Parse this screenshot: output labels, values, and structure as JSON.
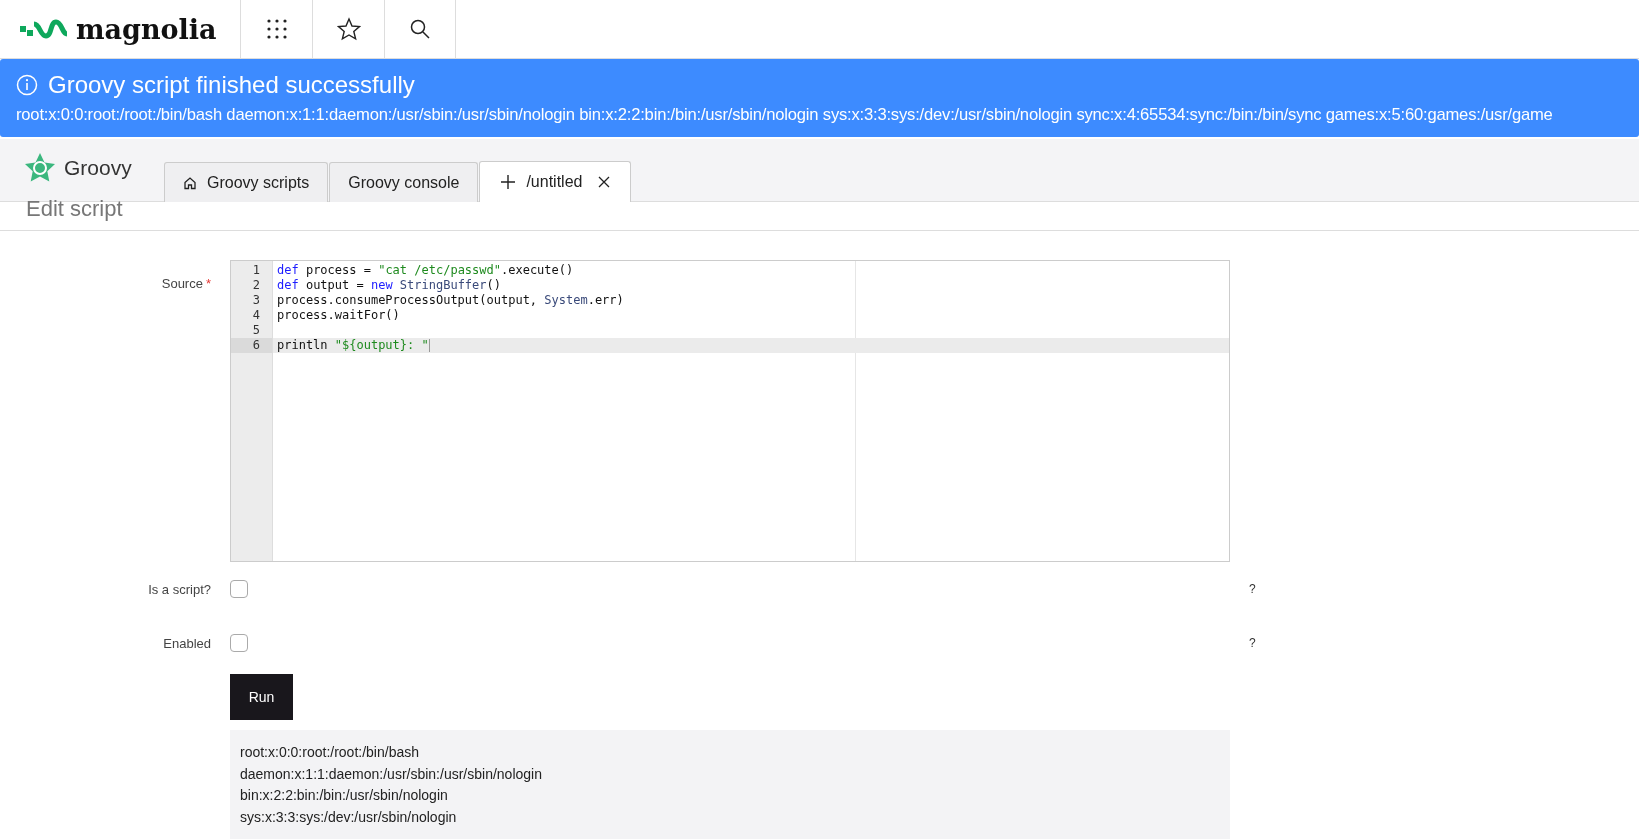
{
  "header": {
    "logo_text": "magnolia"
  },
  "notification": {
    "title": "Groovy script finished successfully",
    "message": "root:x:0:0:root:/root:/bin/bash daemon:x:1:1:daemon:/usr/sbin:/usr/sbin/nologin bin:x:2:2:bin:/bin:/usr/sbin/nologin sys:x:3:3:sys:/dev:/usr/sbin/nologin sync:x:4:65534:sync:/bin:/bin/sync games:x:5:60:games:/usr/game"
  },
  "app": {
    "name": "Groovy"
  },
  "tabs": [
    {
      "kind": "home",
      "label": "Groovy scripts",
      "selected": false,
      "closable": false
    },
    {
      "kind": "plain",
      "label": "Groovy console",
      "selected": false,
      "closable": false
    },
    {
      "kind": "new",
      "label": "/untitled",
      "selected": true,
      "closable": true
    }
  ],
  "page_title": "Edit script",
  "source": {
    "label": "Source",
    "required_mark": "*",
    "lines": [
      {
        "number": "1",
        "active": false,
        "tokens": [
          {
            "kind": "keyword",
            "text": "def"
          },
          {
            "kind": "plain",
            "text": " process = "
          },
          {
            "kind": "string",
            "text": "\"cat /etc/passwd\""
          },
          {
            "kind": "plain",
            "text": ".execute()"
          }
        ]
      },
      {
        "number": "2",
        "active": false,
        "tokens": [
          {
            "kind": "keyword",
            "text": "def"
          },
          {
            "kind": "plain",
            "text": " output = "
          },
          {
            "kind": "keyword",
            "text": "new"
          },
          {
            "kind": "type",
            "text": " StringBuffer"
          },
          {
            "kind": "plain",
            "text": "()"
          }
        ]
      },
      {
        "number": "3",
        "active": false,
        "tokens": [
          {
            "kind": "plain",
            "text": "process.consumeProcessOutput(output, "
          },
          {
            "kind": "type",
            "text": "System"
          },
          {
            "kind": "plain",
            "text": ".err)"
          }
        ]
      },
      {
        "number": "4",
        "active": false,
        "tokens": [
          {
            "kind": "plain",
            "text": "process.waitFor()"
          }
        ]
      },
      {
        "number": "5",
        "active": false
      },
      {
        "number": "6",
        "active": true,
        "tokens": [
          {
            "kind": "plain",
            "text": "println "
          },
          {
            "kind": "string",
            "text": "\"${output}: \""
          }
        ]
      }
    ]
  },
  "fields": [
    {
      "label": "Is a script?",
      "checked": false,
      "help": "?"
    },
    {
      "label": "Enabled",
      "checked": false,
      "help": "?"
    }
  ],
  "run_button": "Run",
  "output": [
    "root:x:0:0:root:/root:/bin/bash",
    "daemon:x:1:1:daemon:/usr/sbin:/usr/sbin/nologin",
    "bin:x:2:2:bin:/bin:/usr/sbin/nologin",
    "sys:x:3:3:sys:/dev:/usr/sbin/nologin"
  ]
}
